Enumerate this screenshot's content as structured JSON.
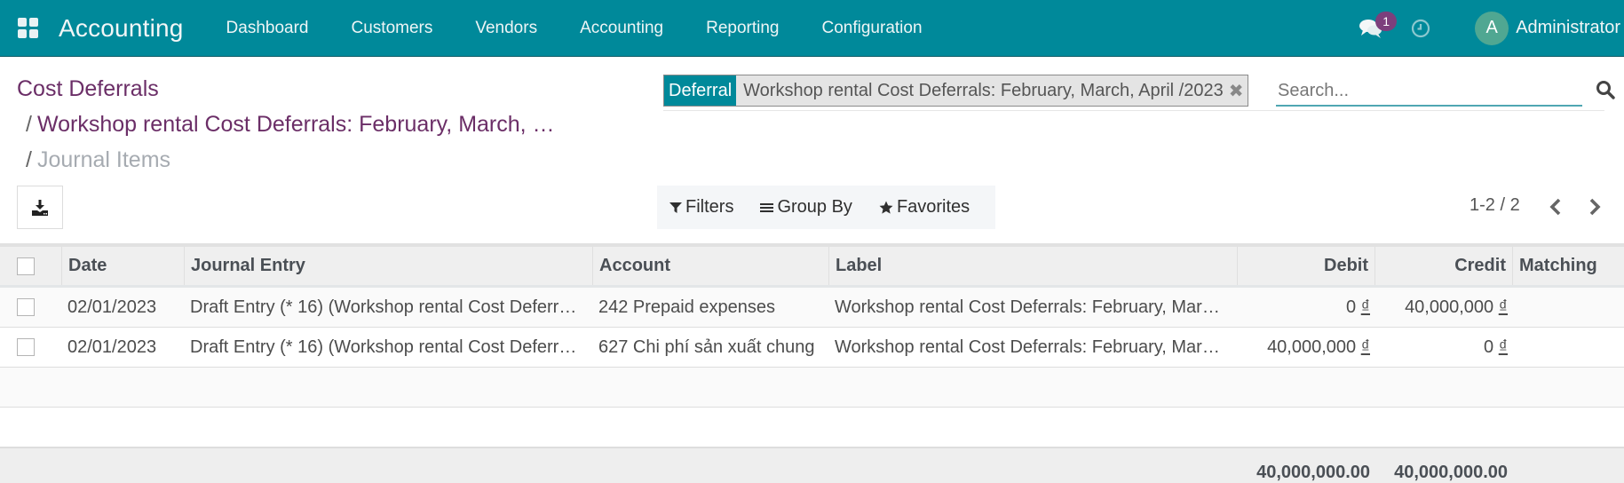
{
  "navbar": {
    "app_title": "Accounting",
    "menu": [
      "Dashboard",
      "Customers",
      "Vendors",
      "Accounting",
      "Reporting",
      "Configuration"
    ],
    "message_count": "1",
    "avatar_initial": "A",
    "user_name": "Administrator",
    "colors": {
      "background": "#00899a",
      "badge": "#7c3f7c",
      "avatar": "#50a792"
    }
  },
  "breadcrumb": {
    "items": [
      "Cost Deferrals",
      "Workshop rental Cost Deferrals: February, March, …"
    ],
    "separator": "/",
    "current": "Journal Items"
  },
  "search": {
    "facet_label": "Deferral",
    "facet_value": "Workshop rental Cost Deferrals: February, March, April /2023",
    "facet_remove": "✖",
    "placeholder": "Search...",
    "value": ""
  },
  "toolbar": {
    "filters_label": "Filters",
    "groupby_label": "Group By",
    "favorites_label": "Favorites"
  },
  "pager": {
    "text": "1-2 / 2"
  },
  "table": {
    "columns": [
      "Date",
      "Journal Entry",
      "Account",
      "Label",
      "Debit",
      "Credit",
      "Matching"
    ],
    "currency_symbol": "₫",
    "rows": [
      {
        "date": "02/01/2023",
        "journal_entry": "Draft Entry (* 16) (Workshop rental Cost Deferr…",
        "account": "242 Prepaid expenses",
        "label": "Workshop rental Cost Deferrals: February, Mar…",
        "debit": "0",
        "credit": "40,000,000",
        "matching": ""
      },
      {
        "date": "02/01/2023",
        "journal_entry": "Draft Entry (* 16) (Workshop rental Cost Deferr…",
        "account": "627 Chi phí sản xuất chung",
        "label": "Workshop rental Cost Deferrals: February, Mar…",
        "debit": "40,000,000",
        "credit": "0",
        "matching": ""
      }
    ],
    "totals": {
      "debit": "40,000,000.00",
      "credit": "40,000,000.00"
    }
  }
}
